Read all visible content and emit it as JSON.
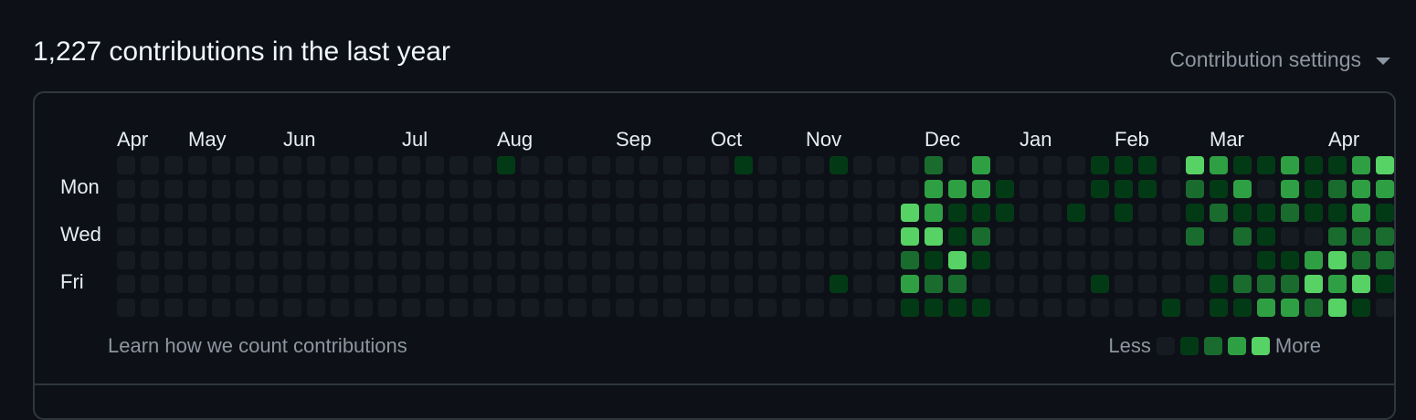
{
  "header": {
    "title": "1,227 contributions in the last year",
    "settings_label": "Contribution settings"
  },
  "months": [
    "Apr",
    "May",
    "Jun",
    "Jul",
    "Aug",
    "Sep",
    "Oct",
    "Nov",
    "Dec",
    "Jan",
    "Feb",
    "Mar",
    "Apr"
  ],
  "day_labels": [
    "Mon",
    "Wed",
    "Fri"
  ],
  "footer": {
    "learn_link": "Learn how we count contributions",
    "legend_less": "Less",
    "legend_more": "More"
  },
  "colors": [
    "#161b22",
    "#033a16",
    "#196c2e",
    "#2ea043",
    "#56d364"
  ],
  "contribution_levels": [
    [
      0,
      0,
      0,
      0,
      0,
      0,
      0
    ],
    [
      0,
      0,
      0,
      0,
      0,
      0,
      0
    ],
    [
      0,
      0,
      0,
      0,
      0,
      0,
      0
    ],
    [
      0,
      0,
      0,
      0,
      0,
      0,
      0
    ],
    [
      0,
      0,
      0,
      0,
      0,
      0,
      0
    ],
    [
      0,
      0,
      0,
      0,
      0,
      0,
      0
    ],
    [
      0,
      0,
      0,
      0,
      0,
      0,
      0
    ],
    [
      0,
      0,
      0,
      0,
      0,
      0,
      0
    ],
    [
      0,
      0,
      0,
      0,
      0,
      0,
      0
    ],
    [
      0,
      0,
      0,
      0,
      0,
      0,
      0
    ],
    [
      0,
      0,
      0,
      0,
      0,
      0,
      0
    ],
    [
      0,
      0,
      0,
      0,
      0,
      0,
      0
    ],
    [
      0,
      0,
      0,
      0,
      0,
      0,
      0
    ],
    [
      0,
      0,
      0,
      0,
      0,
      0,
      0
    ],
    [
      0,
      0,
      0,
      0,
      0,
      0,
      0
    ],
    [
      0,
      0,
      0,
      0,
      0,
      0,
      0
    ],
    [
      1,
      0,
      0,
      0,
      0,
      0,
      0
    ],
    [
      0,
      0,
      0,
      0,
      0,
      0,
      0
    ],
    [
      0,
      0,
      0,
      0,
      0,
      0,
      0
    ],
    [
      0,
      0,
      0,
      0,
      0,
      0,
      0
    ],
    [
      0,
      0,
      0,
      0,
      0,
      0,
      0
    ],
    [
      0,
      0,
      0,
      0,
      0,
      0,
      0
    ],
    [
      0,
      0,
      0,
      0,
      0,
      0,
      0
    ],
    [
      0,
      0,
      0,
      0,
      0,
      0,
      0
    ],
    [
      0,
      0,
      0,
      0,
      0,
      0,
      0
    ],
    [
      0,
      0,
      0,
      0,
      0,
      0,
      0
    ],
    [
      1,
      0,
      0,
      0,
      0,
      0,
      0
    ],
    [
      0,
      0,
      0,
      0,
      0,
      0,
      0
    ],
    [
      0,
      0,
      0,
      0,
      0,
      0,
      0
    ],
    [
      0,
      0,
      0,
      0,
      0,
      0,
      0
    ],
    [
      1,
      0,
      0,
      0,
      0,
      1,
      0
    ],
    [
      0,
      0,
      0,
      0,
      0,
      0,
      0
    ],
    [
      0,
      0,
      0,
      0,
      0,
      0,
      0
    ],
    [
      0,
      0,
      4,
      4,
      2,
      3,
      1
    ],
    [
      2,
      3,
      3,
      4,
      1,
      2,
      1
    ],
    [
      0,
      3,
      1,
      1,
      4,
      2,
      1
    ],
    [
      3,
      3,
      1,
      2,
      1,
      0,
      1
    ],
    [
      0,
      1,
      1,
      0,
      0,
      0,
      0
    ],
    [
      0,
      0,
      0,
      0,
      0,
      0,
      0
    ],
    [
      0,
      0,
      0,
      0,
      0,
      0,
      0
    ],
    [
      0,
      0,
      1,
      0,
      0,
      0,
      0
    ],
    [
      1,
      1,
      0,
      0,
      0,
      1,
      0
    ],
    [
      1,
      1,
      1,
      0,
      0,
      0,
      0
    ],
    [
      1,
      1,
      0,
      0,
      0,
      0,
      0
    ],
    [
      0,
      0,
      0,
      0,
      0,
      0,
      1
    ],
    [
      4,
      2,
      1,
      2,
      0,
      0,
      0
    ],
    [
      3,
      1,
      2,
      0,
      0,
      1,
      1
    ],
    [
      1,
      3,
      1,
      2,
      0,
      2,
      1
    ],
    [
      1,
      0,
      1,
      1,
      1,
      2,
      3
    ],
    [
      3,
      3,
      2,
      0,
      1,
      2,
      3
    ],
    [
      1,
      1,
      1,
      0,
      3,
      4,
      2
    ],
    [
      1,
      2,
      1,
      2,
      4,
      3,
      4
    ],
    [
      3,
      3,
      3,
      2,
      2,
      4,
      1
    ],
    [
      4,
      3,
      1,
      2,
      2,
      1,
      0
    ]
  ]
}
